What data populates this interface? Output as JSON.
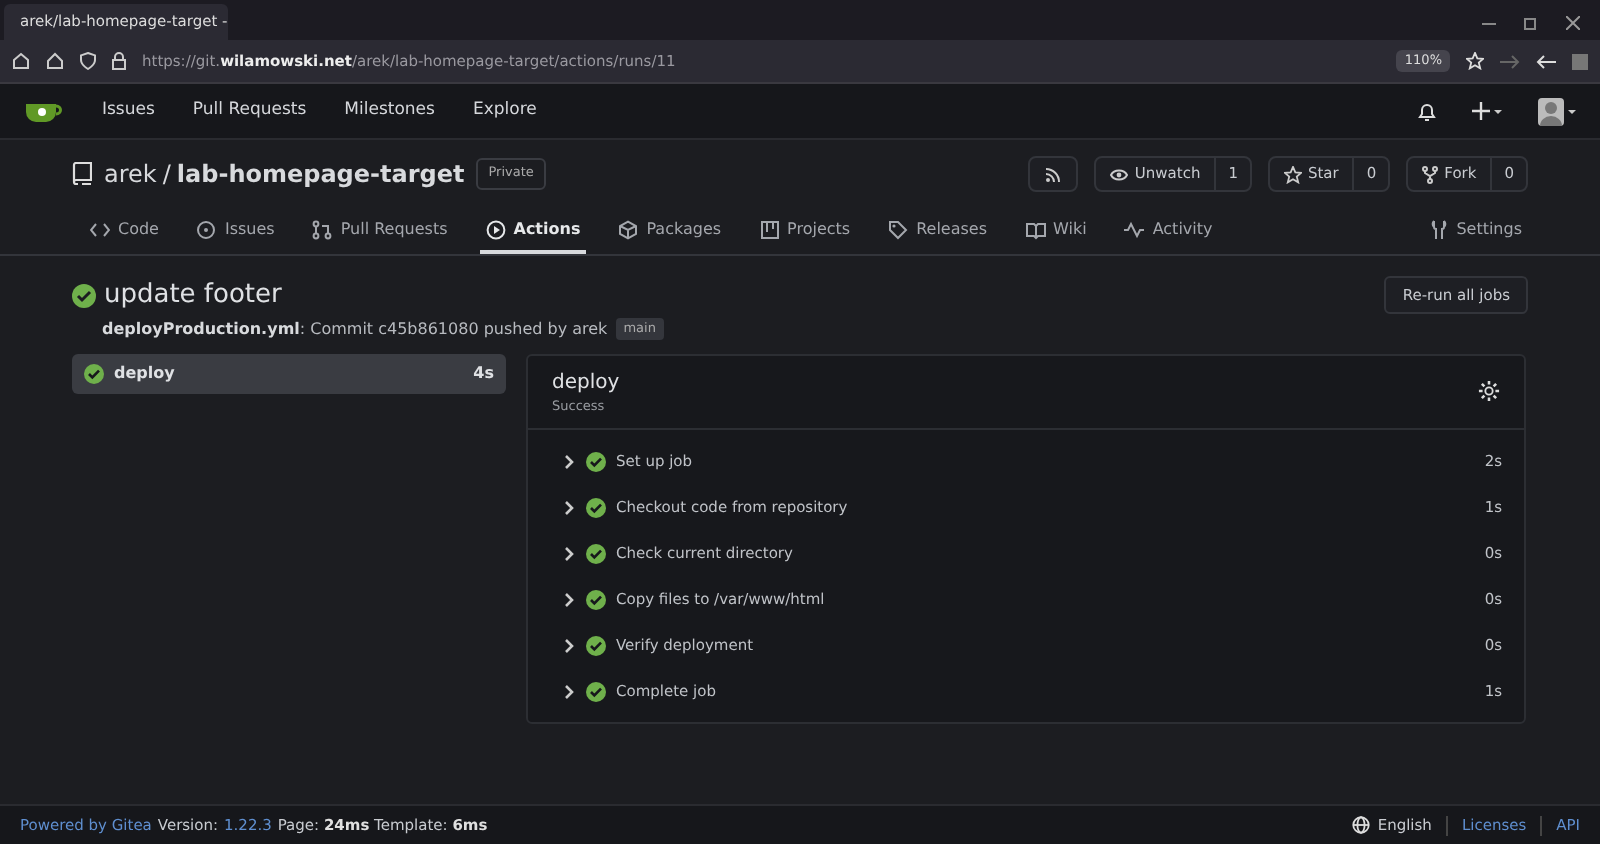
{
  "browser": {
    "tab_title": "arek/lab-homepage-target -",
    "url": "https://git.**wilamowski.net**/arek/lab-homepage-target/actions/runs/11",
    "zoom": "110%"
  },
  "navbar": {
    "items": [
      "Issues",
      "Pull Requests",
      "Milestones",
      "Explore"
    ]
  },
  "repo": {
    "owner": "arek",
    "separator": "/",
    "name": "lab-homepage-target",
    "visibility": "Private",
    "buttons": [
      {
        "label": "Unwatch",
        "count": "1"
      },
      {
        "label": "Star",
        "count": "0"
      },
      {
        "label": "Fork",
        "count": "0"
      }
    ],
    "tabs": [
      {
        "label": "Code",
        "selected": false
      },
      {
        "label": "Issues",
        "selected": false
      },
      {
        "label": "Pull Requests",
        "selected": false
      },
      {
        "label": "Actions",
        "selected": true
      },
      {
        "label": "Packages",
        "selected": false
      },
      {
        "label": "Projects",
        "selected": false
      },
      {
        "label": "Releases",
        "selected": false
      },
      {
        "label": "Wiki",
        "selected": false
      },
      {
        "label": "Activity",
        "selected": false
      }
    ],
    "settings": "Settings"
  },
  "run": {
    "title": "update footer",
    "meta": "**deployProduction.yml**: Commit c45b861080 pushed by arek",
    "branch": "main",
    "rerun": "Re-run all jobs"
  },
  "jobs": [
    {
      "name": "deploy",
      "duration": "4s",
      "selected": true
    }
  ],
  "job_detail": {
    "name": "deploy",
    "status": "Success",
    "steps": [
      {
        "name": "Set up job",
        "duration": "2s"
      },
      {
        "name": "Checkout code from repository",
        "duration": "1s"
      },
      {
        "name": "Check current directory",
        "duration": "0s"
      },
      {
        "name": "Copy files to /var/www/html",
        "duration": "0s"
      },
      {
        "name": "Verify deployment",
        "duration": "0s"
      },
      {
        "name": "Complete job",
        "duration": "1s"
      }
    ]
  },
  "footer": {
    "left": [
      {
        "text": "Powered by Gitea",
        "kind": "link"
      },
      {
        "text": "Version:",
        "kind": "text"
      },
      {
        "text": "1.22.3",
        "kind": "link"
      },
      {
        "text": "Page: **24ms** Template: **6ms**",
        "kind": "text"
      }
    ],
    "language": "English",
    "links": [
      "Licenses",
      "API"
    ]
  }
}
